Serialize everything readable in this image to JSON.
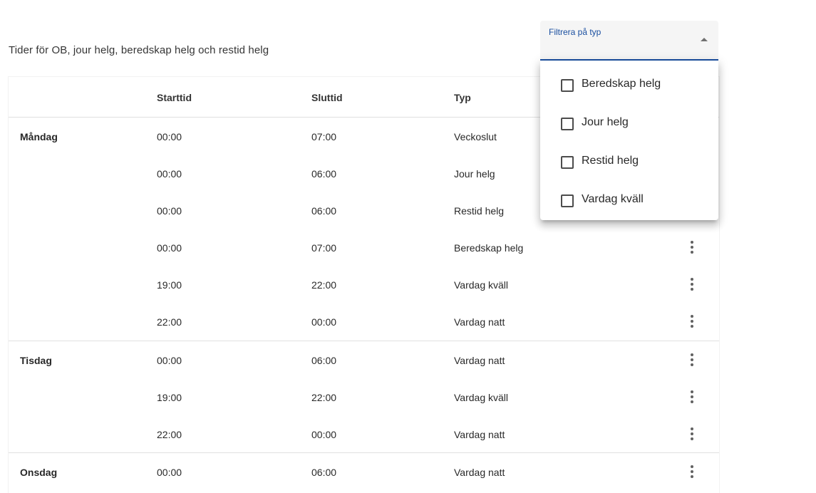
{
  "page": {
    "title": "Tider för OB, jour helg, beredskap helg och restid helg"
  },
  "filter": {
    "label": "Filtrera på typ",
    "options": [
      {
        "label": "Beredskap helg",
        "checked": false
      },
      {
        "label": "Jour helg",
        "checked": false
      },
      {
        "label": "Restid helg",
        "checked": false
      },
      {
        "label": "Vardag kväll",
        "checked": false
      }
    ]
  },
  "table": {
    "columns": [
      "",
      "Starttid",
      "Sluttid",
      "Typ"
    ],
    "groups": [
      {
        "day": "Måndag",
        "rows": [
          {
            "start": "00:00",
            "end": "07:00",
            "type": "Veckoslut"
          },
          {
            "start": "00:00",
            "end": "06:00",
            "type": "Jour helg"
          },
          {
            "start": "00:00",
            "end": "06:00",
            "type": "Restid helg"
          },
          {
            "start": "00:00",
            "end": "07:00",
            "type": "Beredskap helg"
          },
          {
            "start": "19:00",
            "end": "22:00",
            "type": "Vardag kväll"
          },
          {
            "start": "22:00",
            "end": "00:00",
            "type": "Vardag natt"
          }
        ]
      },
      {
        "day": "Tisdag",
        "rows": [
          {
            "start": "00:00",
            "end": "06:00",
            "type": "Vardag natt"
          },
          {
            "start": "19:00",
            "end": "22:00",
            "type": "Vardag kväll"
          },
          {
            "start": "22:00",
            "end": "00:00",
            "type": "Vardag natt"
          }
        ]
      },
      {
        "day": "Onsdag",
        "rows": [
          {
            "start": "00:00",
            "end": "06:00",
            "type": "Vardag natt"
          }
        ]
      }
    ]
  },
  "icons": {
    "row_menu": "more-vert-icon",
    "select_arrow": "arrow-drop-up-icon",
    "checkbox": "checkbox-unchecked-icon"
  },
  "colors": {
    "accent": "#1a4fa0",
    "select_background": "#f5f5f5"
  }
}
